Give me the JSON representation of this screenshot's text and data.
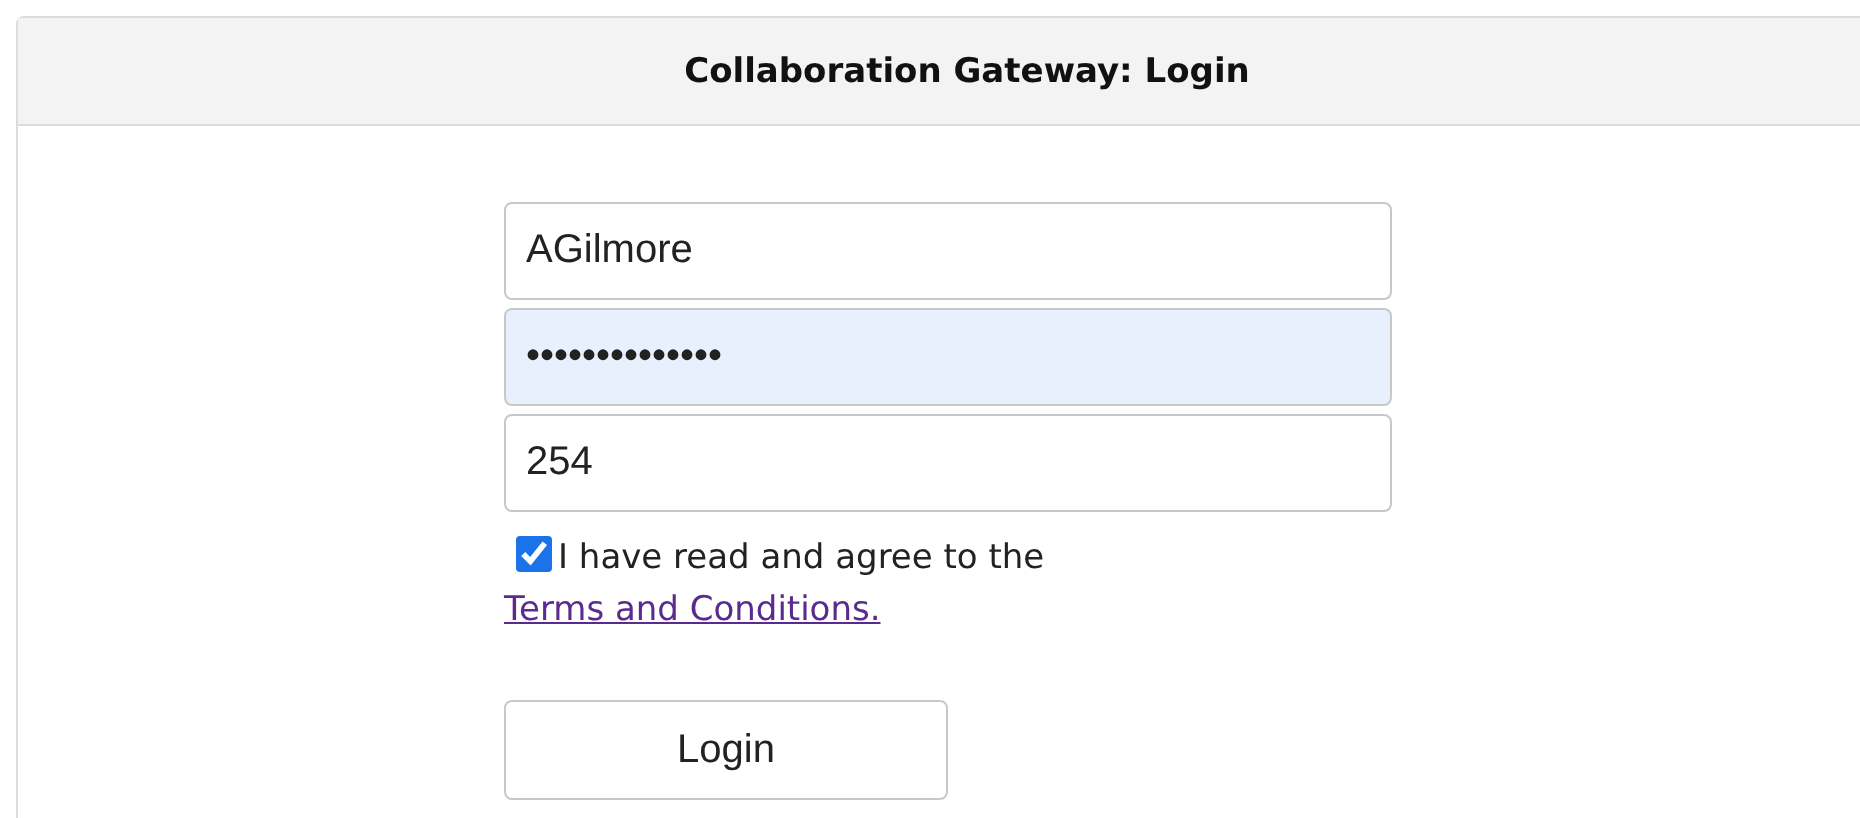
{
  "header": {
    "title": "Collaboration Gateway: Login"
  },
  "fields": [
    {
      "value": "AGilmore",
      "autofilled": false
    },
    {
      "value": "••••••••••••••",
      "autofilled": true
    },
    {
      "value": "254",
      "autofilled": false
    }
  ],
  "agreement": {
    "checked": true,
    "text": "I have read and agree to the",
    "link": "Terms and Conditions."
  },
  "buttons": [
    "Login"
  ]
}
